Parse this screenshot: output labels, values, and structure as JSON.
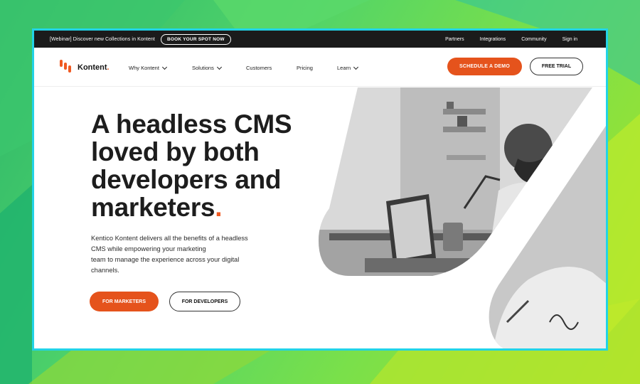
{
  "topbar": {
    "webinar": "[Webinar] Discover new Collections in Kontent",
    "cta": "BOOK YOUR SPOT NOW",
    "links": [
      "Partners",
      "Integrations",
      "Community",
      "Sign in"
    ]
  },
  "logo": {
    "name": "Kontent"
  },
  "nav": {
    "items": [
      {
        "label": "Why Kontent",
        "dropdown": true
      },
      {
        "label": "Solutions",
        "dropdown": true
      },
      {
        "label": "Customers",
        "dropdown": false
      },
      {
        "label": "Pricing",
        "dropdown": false
      },
      {
        "label": "Learn",
        "dropdown": true
      }
    ],
    "demo": "SCHEDULE A DEMO",
    "trial": "FREE TRIAL"
  },
  "hero": {
    "title_lines": [
      "A headless CMS",
      "loved by both",
      "developers and",
      "marketers"
    ],
    "title_dot": ".",
    "desc_lines": [
      "Kentico Kontent delivers all the benefits of a headless",
      "CMS while empowering your marketing",
      "team to manage the experience across your digital",
      "channels."
    ],
    "btn_marketers": "FOR MARKETERS",
    "btn_developers": "FOR DEVELOPERS"
  },
  "colors": {
    "accent": "#e5531c",
    "frame": "#22d3e6",
    "dark": "#1b1b1b"
  }
}
